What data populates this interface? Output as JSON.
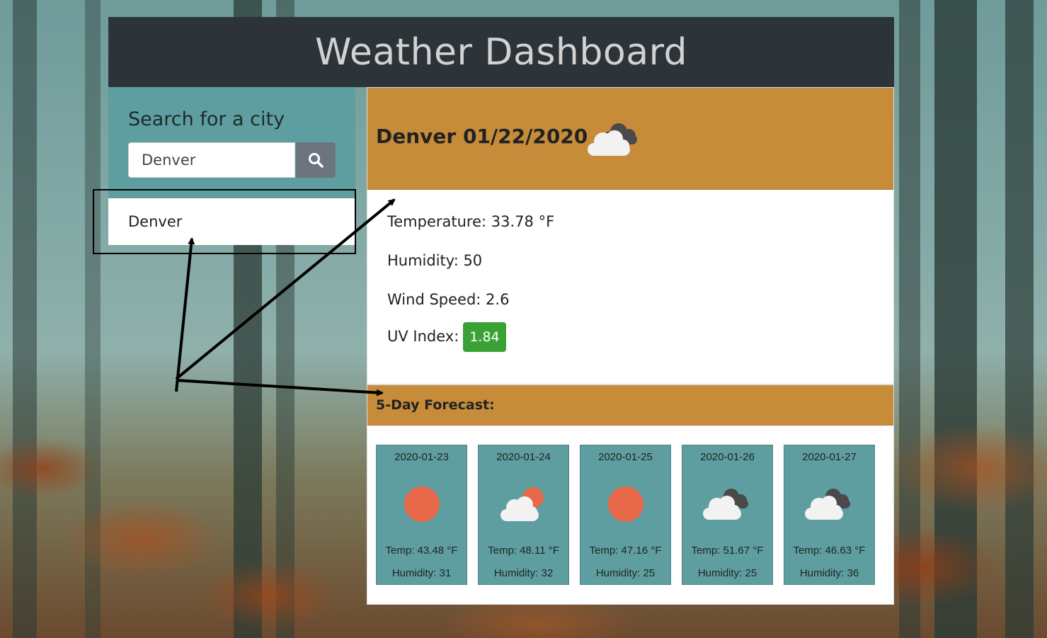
{
  "app": {
    "title": "Weather Dashboard"
  },
  "sidebar": {
    "heading": "Search for a city",
    "search": {
      "value": "Denver",
      "placeholder": ""
    },
    "history": [
      "Denver"
    ]
  },
  "current": {
    "title": "Denver 01/22/2020",
    "icon": "cloudy-icon",
    "temperature": "Temperature: 33.78 °F",
    "humidity": "Humidity: 50",
    "wind": "Wind Speed: 2.6",
    "uv_label": "UV Index:",
    "uv_value": "1.84"
  },
  "forecast": {
    "title": "5-Day Forecast:",
    "days": [
      {
        "date": "2020-01-23",
        "icon": "sun-icon",
        "temp": "Temp: 43.48 °F",
        "humidity": "Humidity: 31"
      },
      {
        "date": "2020-01-24",
        "icon": "partly-cloudy-icon",
        "temp": "Temp: 48.11 °F",
        "humidity": "Humidity: 32"
      },
      {
        "date": "2020-01-25",
        "icon": "sun-icon",
        "temp": "Temp: 47.16 °F",
        "humidity": "Humidity: 25"
      },
      {
        "date": "2020-01-26",
        "icon": "cloudy-icon",
        "temp": "Temp: 51.67 °F",
        "humidity": "Humidity: 25"
      },
      {
        "date": "2020-01-27",
        "icon": "cloudy-icon",
        "temp": "Temp: 46.63 °F",
        "humidity": "Humidity: 36"
      }
    ]
  },
  "colors": {
    "header_bg": "#2c343a",
    "panel_teal": "#5f9ea0",
    "accent_orange": "#c68c3a",
    "uv_green": "#3aa235",
    "sun": "#e8694a"
  }
}
